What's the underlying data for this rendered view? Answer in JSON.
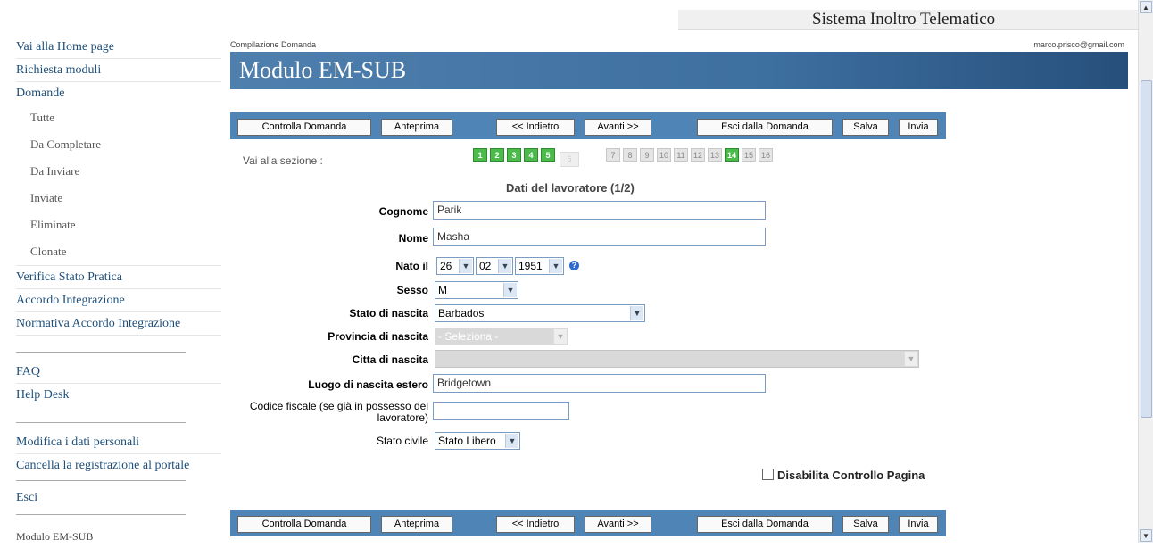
{
  "system_title": "Sistema Inoltro Telematico",
  "breadcrumb": "Compilazione Domanda",
  "user_email": "marco.prisco@gmail.com",
  "page_title": "Modulo EM-SUB",
  "sidebar": {
    "home": "Vai alla Home page",
    "richiesta": "Richiesta moduli",
    "domande": "Domande",
    "sub": [
      "Tutte",
      "Da Completare",
      "Da Inviare",
      "Inviate",
      "Eliminate",
      "Clonate"
    ],
    "verifica": "Verifica Stato Pratica",
    "accordo": "Accordo Integrazione",
    "normativa": "Normativa Accordo Integrazione",
    "faq": "FAQ",
    "helpdesk": "Help Desk",
    "modifica": "Modifica i dati personali",
    "cancella": "Cancella la registrazione al portale",
    "esci": "Esci",
    "footer": "Modulo EM-SUB"
  },
  "toolbar": {
    "controlla": "Controlla Domanda",
    "anteprima": "Anteprima",
    "indietro": "<< Indietro",
    "avanti": "Avanti >>",
    "esci": "Esci dalla Domanda",
    "salva": "Salva",
    "invia": "Invia"
  },
  "sections": {
    "label": "Vai alla sezione :",
    "items": [
      "1",
      "2",
      "3",
      "4",
      "5",
      "6",
      "7",
      "8",
      "9",
      "10",
      "11",
      "12",
      "13",
      "14",
      "15",
      "16"
    ]
  },
  "form": {
    "title": "Dati del lavoratore (1/2)",
    "cognome_label": "Cognome",
    "cognome": "Parik",
    "nome_label": "Nome",
    "nome": "Masha",
    "nato_label": "Nato il",
    "day": "26",
    "month": "02",
    "year": "1951",
    "sesso_label": "Sesso",
    "sesso": "M",
    "stato_nascita_label": "Stato di nascita",
    "stato_nascita": "Barbados",
    "provincia_label": "Provincia di nascita",
    "provincia": "- Seleziona -",
    "citta_label": "Citta di nascita",
    "citta": "",
    "luogo_estero_label": "Luogo di nascita estero",
    "luogo_estero": "Bridgetown",
    "codice_fiscale_label_1": "Codice fiscale (se già in possesso del",
    "codice_fiscale_label_2": "lavoratore)",
    "codice_fiscale": "",
    "stato_civile_label": "Stato civile",
    "stato_civile": "Stato Libero",
    "disabilita": "Disabilita Controllo Pagina"
  },
  "colors": {
    "header_blue": "#3d6f9f",
    "toolbar_blue": "#4f84b6",
    "section_green": "#4cbb4c",
    "link_blue": "#1e4f7a"
  }
}
